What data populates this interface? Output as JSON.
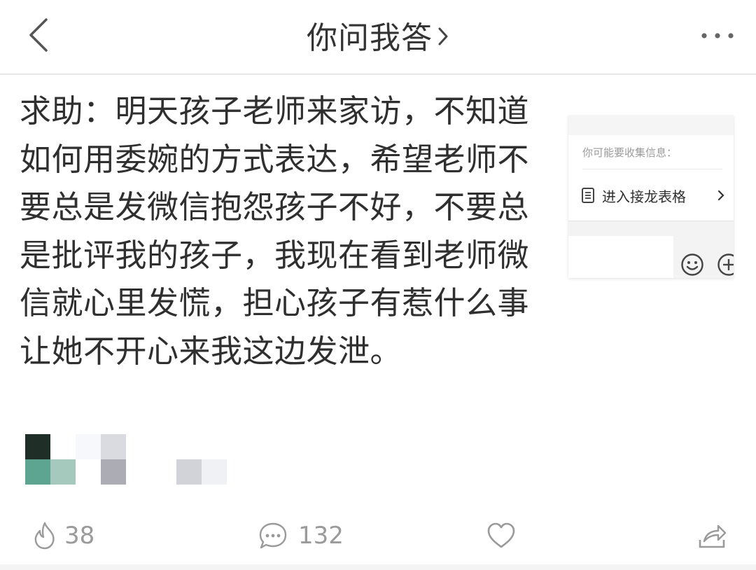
{
  "header": {
    "title": "你问我答",
    "icons": {
      "back": "chevron-left-icon",
      "title_arrow": "chevron-right-icon",
      "more": "more-horizontal-icon"
    }
  },
  "post": {
    "text": "求助：明天孩子老师来家访，不知道如何用委婉的方式表达，希望老师不要总是发微信抱怨孩子不好，不要总是批评我的孩子，我现在看到老师微信就心里发慌，担心孩子有惹什么事让她不开心来我这边发泄。"
  },
  "embed": {
    "hint": "你可能要收集信息：",
    "row_label": "进入接龙表格",
    "icons": {
      "doc": "document-icon",
      "arrow": "chevron-right-icon",
      "emoji": "smiley-icon",
      "plus": "plus-circle-icon"
    }
  },
  "mosaic": {
    "colors": [
      "#1f2e27",
      "#f7f8fb",
      "#dadbe0",
      "#5da590",
      "#a5c9bd",
      "#acacb4",
      "#d2d3d8",
      "#f0f1f5"
    ]
  },
  "actions": {
    "like_count": "38",
    "comment_count": "132",
    "icons": {
      "like": "flame-icon",
      "comment": "comment-icon",
      "favorite": "heart-icon",
      "share": "share-icon"
    }
  },
  "colors": {
    "icon_gray": "#9a9a9a",
    "text": "#2f2f2f",
    "divider": "#e6e6e6"
  }
}
